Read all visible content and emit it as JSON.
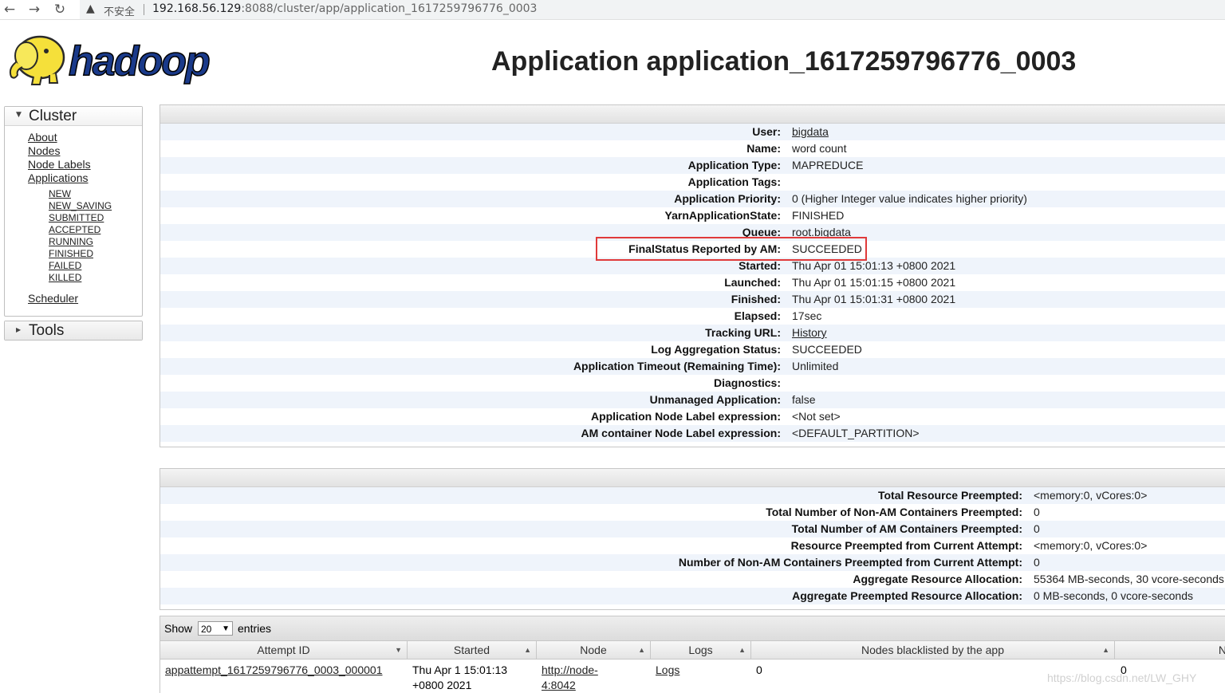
{
  "browser": {
    "insecure_label": "不安全",
    "url_host": "192.168.56.129",
    "url_rest": ":8088/cluster/app/application_1617259796776_0003"
  },
  "page": {
    "title": "Application application_1617259796776_0003"
  },
  "sidebar": {
    "cluster_label": "Cluster",
    "links": [
      "About",
      "Nodes",
      "Node Labels",
      "Applications"
    ],
    "states": [
      "NEW",
      "NEW_SAVING",
      "SUBMITTED",
      "ACCEPTED",
      "RUNNING",
      "FINISHED",
      "FAILED",
      "KILLED"
    ],
    "scheduler": "Scheduler",
    "tools_label": "Tools"
  },
  "overview": [
    {
      "k": "User:",
      "v": "bigdata",
      "link": true
    },
    {
      "k": "Name:",
      "v": "word count"
    },
    {
      "k": "Application Type:",
      "v": "MAPREDUCE"
    },
    {
      "k": "Application Tags:",
      "v": ""
    },
    {
      "k": "Application Priority:",
      "v": "0 (Higher Integer value indicates higher priority)"
    },
    {
      "k": "YarnApplicationState:",
      "v": "FINISHED"
    },
    {
      "k": "Queue:",
      "v": "root.bigdata",
      "link": true
    },
    {
      "k": "FinalStatus Reported by AM:",
      "v": "SUCCEEDED"
    },
    {
      "k": "Started:",
      "v": "Thu Apr 01 15:01:13 +0800 2021"
    },
    {
      "k": "Launched:",
      "v": "Thu Apr 01 15:01:15 +0800 2021"
    },
    {
      "k": "Finished:",
      "v": "Thu Apr 01 15:01:31 +0800 2021"
    },
    {
      "k": "Elapsed:",
      "v": "17sec"
    },
    {
      "k": "Tracking URL:",
      "v": "History",
      "link": true
    },
    {
      "k": "Log Aggregation Status:",
      "v": "SUCCEEDED"
    },
    {
      "k": "Application Timeout (Remaining Time):",
      "v": "Unlimited"
    },
    {
      "k": "Diagnostics:",
      "v": ""
    },
    {
      "k": "Unmanaged Application:",
      "v": "false"
    },
    {
      "k": "Application Node Label expression:",
      "v": "<Not set>"
    },
    {
      "k": "AM container Node Label expression:",
      "v": "<DEFAULT_PARTITION>"
    }
  ],
  "metrics": [
    {
      "k": "Total Resource Preempted:",
      "v": "<memory:0, vCores:0>"
    },
    {
      "k": "Total Number of Non-AM Containers Preempted:",
      "v": "0"
    },
    {
      "k": "Total Number of AM Containers Preempted:",
      "v": "0"
    },
    {
      "k": "Resource Preempted from Current Attempt:",
      "v": "<memory:0, vCores:0>"
    },
    {
      "k": "Number of Non-AM Containers Preempted from Current Attempt:",
      "v": "0"
    },
    {
      "k": "Aggregate Resource Allocation:",
      "v": "55364 MB-seconds, 30 vcore-seconds"
    },
    {
      "k": "Aggregate Preempted Resource Allocation:",
      "v": "0 MB-seconds, 0 vcore-seconds"
    }
  ],
  "attempts": {
    "show_label": "Show",
    "page_size": "20",
    "entries_label": "entries",
    "columns": [
      "Attempt ID",
      "Started",
      "Node",
      "Logs",
      "Nodes blacklisted by the app",
      "N"
    ],
    "row": {
      "attempt_id": "appattempt_1617259796776_0003_000001",
      "started_1": "Thu Apr 1 15:01:13",
      "started_2": "+0800 2021",
      "node_1": "http://node-",
      "node_2": "4:8042",
      "logs": "Logs",
      "blacklisted": "0",
      "n": "0"
    }
  },
  "watermark": "https://blog.csdn.net/LW_GHY"
}
